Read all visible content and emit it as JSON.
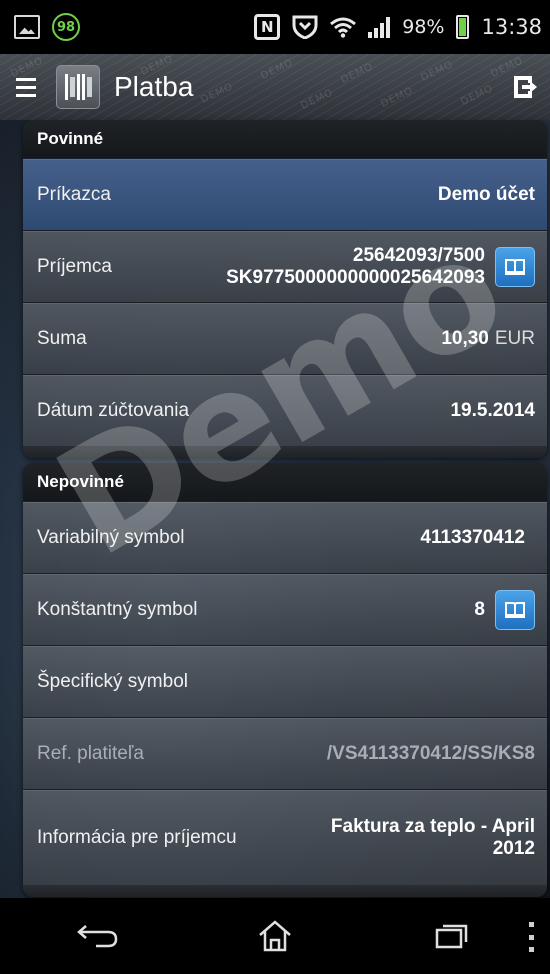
{
  "status_bar": {
    "notification_badge": "98",
    "battery_percent": "98%",
    "time": "13:38",
    "icons": [
      "image-icon",
      "nfc-icon",
      "heart-shield-icon",
      "wifi-icon",
      "signal-icon",
      "battery-icon"
    ]
  },
  "action_bar": {
    "title": "Platba",
    "watermark_text": "DEMO"
  },
  "required_section": {
    "header": "Povinné",
    "rows": [
      {
        "label": "Príkazca",
        "value": "Demo účet"
      },
      {
        "label": "Príjemca",
        "value_line1": "25642093/7500",
        "value_line2": "SK9775000000000025642093"
      },
      {
        "label": "Suma",
        "value": "10,30",
        "unit": "EUR"
      },
      {
        "label": "Dátum zúčtovania",
        "value": "19.5.2014"
      }
    ]
  },
  "optional_section": {
    "header": "Nepovinné",
    "rows": [
      {
        "label": "Variabilný symbol",
        "value": "4113370412"
      },
      {
        "label": "Konštantný symbol",
        "value": "8"
      },
      {
        "label": "Špecifický symbol",
        "value": ""
      },
      {
        "label": "Ref. platiteľa",
        "value": "/VS4113370412/SS/KS8"
      },
      {
        "label": "Informácia pre príjemcu",
        "value_line1": "Faktura za teplo - April",
        "value_line2": "2012"
      }
    ]
  },
  "watermark": "Demo",
  "colors": {
    "accent_blue": "#2f78c8",
    "selected_row": "#3a5580",
    "badge_green": "#6fd14a"
  }
}
